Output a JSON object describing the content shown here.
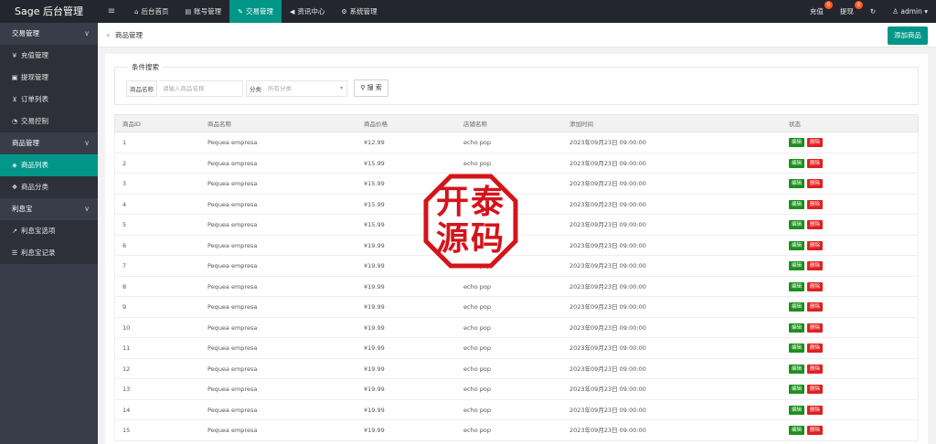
{
  "app": {
    "title": "Sage 后台管理"
  },
  "topnav": {
    "toggle": "≡",
    "items": [
      {
        "label": "后台首页",
        "icon": "home-icon",
        "glyph": "⌂"
      },
      {
        "label": "账号管理",
        "icon": "id-card-icon",
        "glyph": "▤"
      },
      {
        "label": "交易管理",
        "icon": "gavel-icon",
        "glyph": "✎",
        "active": true
      },
      {
        "label": "资讯中心",
        "icon": "megaphone-icon",
        "glyph": "◀"
      },
      {
        "label": "系统管理",
        "icon": "gears-icon",
        "glyph": "⚙"
      }
    ],
    "right": {
      "recharge": "充值",
      "recharge_badge": "0",
      "withdraw": "提现",
      "withdraw_badge": "0",
      "refresh": "↻",
      "user": "admin",
      "user_glyph": "♙",
      "caret": "▾"
    }
  },
  "sidebar": {
    "groups": [
      {
        "label": "交易管理",
        "chev": "∨",
        "items": [
          {
            "label": "充值管理",
            "icon": "yen-icon",
            "glyph": "¥"
          },
          {
            "label": "提现管理",
            "icon": "money-icon",
            "glyph": "▣"
          },
          {
            "label": "订单列表",
            "icon": "cart-icon",
            "glyph": "⊻"
          },
          {
            "label": "交易控制",
            "icon": "dashboard-icon",
            "glyph": "◔"
          }
        ]
      },
      {
        "label": "商品管理",
        "chev": "∨",
        "items": [
          {
            "label": "商品列表",
            "icon": "cube-icon",
            "glyph": "◈",
            "active": true
          },
          {
            "label": "商品分类",
            "icon": "cubes-icon",
            "glyph": "❖"
          }
        ]
      },
      {
        "label": "利息宝",
        "chev": "∨",
        "items": [
          {
            "label": "利息宝选项",
            "icon": "line-chart-icon",
            "glyph": "↗"
          },
          {
            "label": "利息宝记录",
            "icon": "sliders-icon",
            "glyph": "☰"
          }
        ]
      }
    ]
  },
  "breadcrumb": {
    "arrow": "»",
    "label": "商品管理"
  },
  "add_button": "添加商品",
  "search": {
    "legend": "条件搜索",
    "name_label": "商品名称",
    "name_placeholder": "请输入商品名称",
    "category_label": "分类",
    "category_value": "所有分类",
    "button": "搜 索",
    "button_glyph": "⚲"
  },
  "table": {
    "headers": [
      "商品ID",
      "商品名称",
      "商品价格",
      "店铺名称",
      "添加时间",
      "状态"
    ],
    "edit_label": "编辑",
    "delete_label": "删除",
    "rows": [
      {
        "id": "1",
        "name": "Pequea empresa",
        "price": "¥12.99",
        "shop": "echo pop",
        "time": "2023年09月23日 09:00:00"
      },
      {
        "id": "2",
        "name": "Pequea empresa",
        "price": "¥15.99",
        "shop": "echo pop",
        "time": "2023年09月23日 09:00:00"
      },
      {
        "id": "3",
        "name": "Pequea empresa",
        "price": "¥15.99",
        "shop": "echo pop",
        "time": "2023年09月23日 09:00:00"
      },
      {
        "id": "4",
        "name": "Pequea empresa",
        "price": "¥15.99",
        "shop": "echo pop",
        "time": "2023年09月23日 09:00:00"
      },
      {
        "id": "5",
        "name": "Pequea empresa",
        "price": "¥15.99",
        "shop": "echo pop",
        "time": "2023年09月23日 09:00:00"
      },
      {
        "id": "6",
        "name": "Pequea empresa",
        "price": "¥19.99",
        "shop": "echo pop",
        "time": "2023年09月23日 09:00:00"
      },
      {
        "id": "7",
        "name": "Pequea empresa",
        "price": "¥19.99",
        "shop": "echo pop",
        "time": "2023年09月23日 09:00:00"
      },
      {
        "id": "8",
        "name": "Pequea empresa",
        "price": "¥19.99",
        "shop": "echo pop",
        "time": "2023年09月23日 09:00:00"
      },
      {
        "id": "9",
        "name": "Pequea empresa",
        "price": "¥19.99",
        "shop": "echo pop",
        "time": "2023年09月23日 09:00:00"
      },
      {
        "id": "10",
        "name": "Pequea empresa",
        "price": "¥19.99",
        "shop": "echo pop",
        "time": "2023年09月23日 09:00:00"
      },
      {
        "id": "11",
        "name": "Pequea empresa",
        "price": "¥19.99",
        "shop": "echo pop",
        "time": "2023年09月23日 09:00:00"
      },
      {
        "id": "12",
        "name": "Pequea empresa",
        "price": "¥19.99",
        "shop": "echo pop",
        "time": "2023年09月23日 09:00:00"
      },
      {
        "id": "13",
        "name": "Pequea empresa",
        "price": "¥19.99",
        "shop": "echo pop",
        "time": "2023年09月23日 09:00:00"
      },
      {
        "id": "14",
        "name": "Pequea empresa",
        "price": "¥19.99",
        "shop": "echo pop",
        "time": "2023年09月23日 09:00:00"
      },
      {
        "id": "15",
        "name": "Pequea empresa",
        "price": "¥19.99",
        "shop": "echo pop",
        "time": "2023年09月23日 09:00:00"
      }
    ]
  },
  "watermark": {
    "chars": [
      "开",
      "泰",
      "源",
      "码"
    ],
    "color": "#d4141a"
  },
  "colors": {
    "accent": "#009688",
    "topbar": "#23262e",
    "sidebar": "#393d49",
    "edit": "#1e8e1e",
    "delete": "#e02020",
    "badge": "#ff5722"
  }
}
